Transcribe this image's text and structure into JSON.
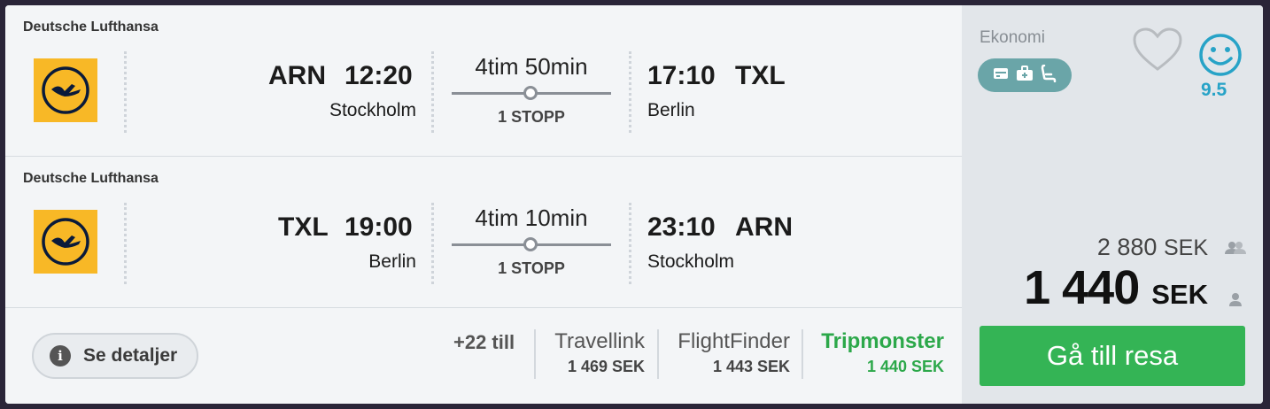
{
  "legs": [
    {
      "airline": "Deutsche Lufthansa",
      "dep_code": "ARN",
      "dep_time": "12:20",
      "dep_city": "Stockholm",
      "duration": "4tim 50min",
      "stops": "1 STOPP",
      "arr_time": "17:10",
      "arr_code": "TXL",
      "arr_city": "Berlin"
    },
    {
      "airline": "Deutsche Lufthansa",
      "dep_code": "TXL",
      "dep_time": "19:00",
      "dep_city": "Berlin",
      "duration": "4tim 10min",
      "stops": "1 STOPP",
      "arr_time": "23:10",
      "arr_code": "ARN",
      "arr_city": "Stockholm"
    }
  ],
  "footer": {
    "details_label": "Se detaljer",
    "more_providers": "+22 till",
    "providers": [
      {
        "name": "Travellink",
        "price": "1 469 SEK"
      },
      {
        "name": "FlightFinder",
        "price": "1 443 SEK"
      },
      {
        "name": "Tripmonster",
        "price": "1 440 SEK"
      }
    ]
  },
  "sidebar": {
    "cabin": "Ekonomi",
    "score": "9.5",
    "total_price": "2 880",
    "total_currency": "SEK",
    "price_value": "1 440",
    "price_currency": "SEK",
    "go_label": "Gå till resa"
  },
  "colors": {
    "accent_green": "#34b455",
    "score_blue": "#27a3c7",
    "logo_yellow": "#f8b826",
    "amenity_teal": "#6aa5a8"
  },
  "icons": [
    "lufthansa-logo",
    "info-icon",
    "wifi-icon",
    "luggage-icon",
    "seat-icon",
    "heart-icon",
    "smiley-icon",
    "group-icon",
    "person-icon"
  ]
}
